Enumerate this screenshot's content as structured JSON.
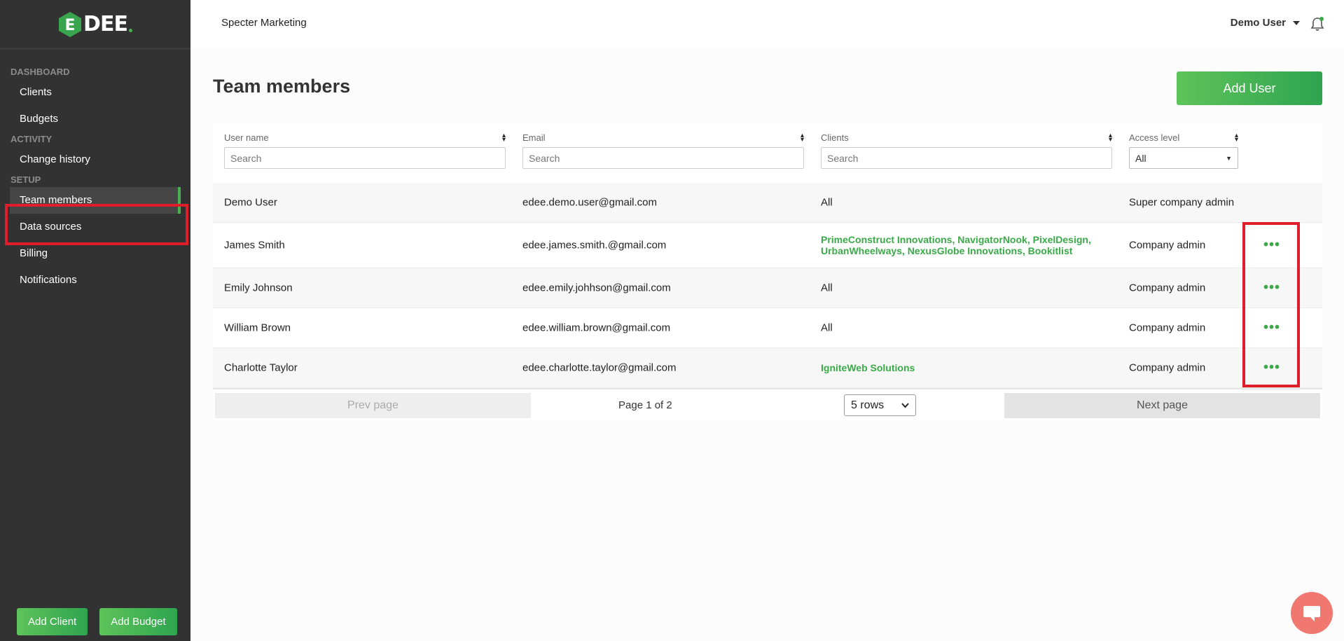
{
  "brand": {
    "logo_letter": "E",
    "logo_text": "DEE"
  },
  "sidebar": {
    "sections": [
      {
        "label": "DASHBOARD",
        "items": [
          {
            "label": "Clients"
          },
          {
            "label": "Budgets"
          }
        ]
      },
      {
        "label": "ACTIVITY",
        "items": [
          {
            "label": "Change history"
          }
        ]
      },
      {
        "label": "SETUP",
        "items": [
          {
            "label": "Team members",
            "active": true
          },
          {
            "label": "Data sources"
          },
          {
            "label": "Billing"
          },
          {
            "label": "Notifications"
          }
        ]
      }
    ],
    "add_client_label": "Add Client",
    "add_budget_label": "Add Budget"
  },
  "header": {
    "company": "Specter Marketing",
    "user": "Demo User",
    "bell_icon": "bell-icon"
  },
  "page": {
    "title": "Team members",
    "add_user_label": "Add User"
  },
  "table": {
    "columns": [
      {
        "label": "User name",
        "placeholder": "Search"
      },
      {
        "label": "Email",
        "placeholder": "Search"
      },
      {
        "label": "Clients",
        "placeholder": "Search"
      },
      {
        "label": "Access level",
        "selected": "All"
      }
    ],
    "rows": [
      {
        "name": "Demo User",
        "email": "edee.demo.user@gmail.com",
        "clients": "All",
        "clients_line2": "",
        "access": "Super company admin",
        "actions": ""
      },
      {
        "name": "James Smith",
        "email": "edee.james.smith.@gmail.com",
        "clients": "PrimeConstruct Innovations,  NavigatorNook,  PixelDesign,",
        "clients_line2": "UrbanWheelways,  NexusGlobe Innovations,  Bookitlist",
        "access": "Company admin",
        "actions": "•••"
      },
      {
        "name": "Emily Johnson",
        "email": "edee.emily.johhson@gmail.com",
        "clients": "All",
        "clients_line2": "",
        "access": "Company admin",
        "actions": "•••"
      },
      {
        "name": "William Brown",
        "email": "edee.william.brown@gmail.com",
        "clients": "All",
        "clients_line2": "",
        "access": "Company admin",
        "actions": "•••"
      },
      {
        "name": "Charlotte Taylor",
        "email": "edee.charlotte.taylor@gmail.com",
        "clients": "IgniteWeb Solutions",
        "clients_line2": "",
        "access": "Company admin",
        "actions": "•••"
      }
    ]
  },
  "pager": {
    "prev_label": "Prev page",
    "page_info": "Page 1 of 2",
    "rows_label": "5 rows",
    "next_label": "Next page"
  },
  "colors": {
    "accent": "#3aaa49",
    "sidebar_bg": "#333233",
    "highlight": "#e01e2b",
    "chat": "#f07870"
  }
}
